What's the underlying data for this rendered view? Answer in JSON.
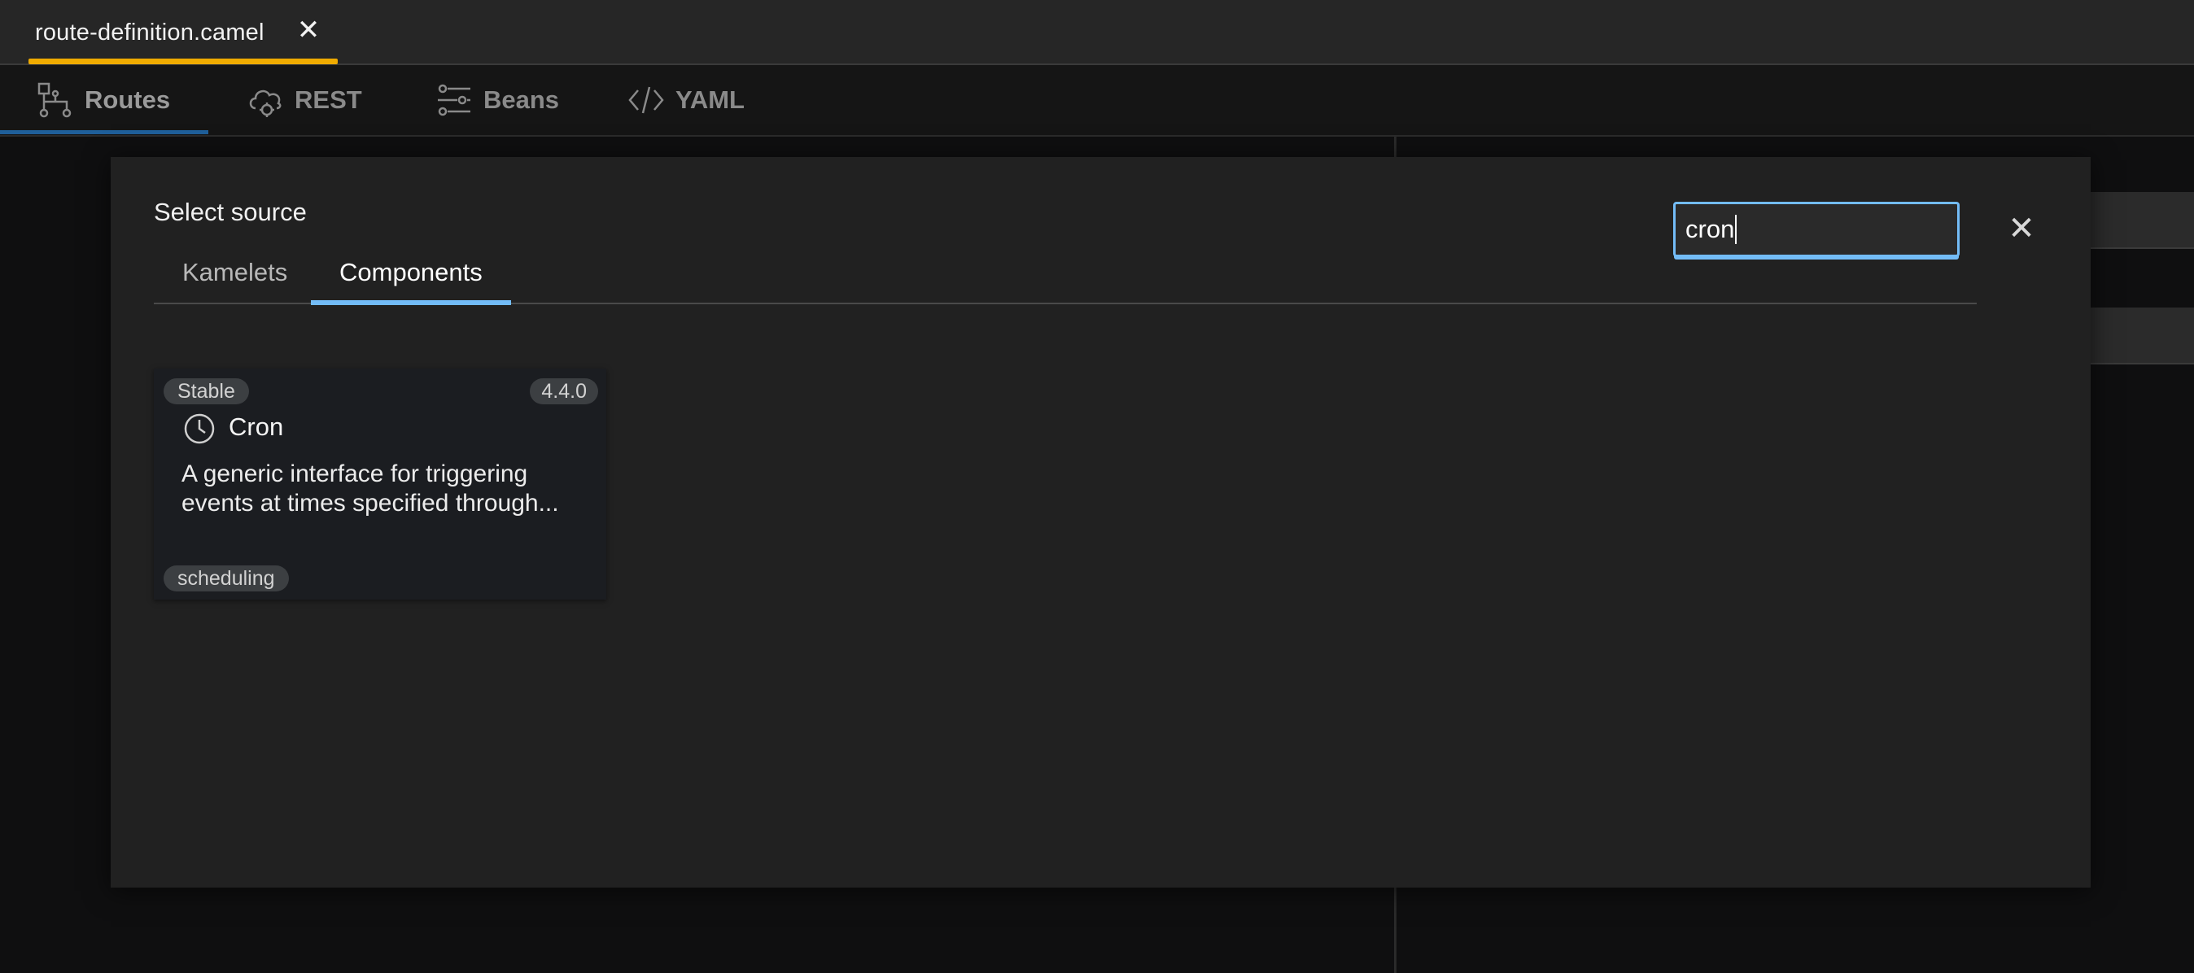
{
  "editor_tab": {
    "filename": "route-definition.camel",
    "close_glyph": "✕"
  },
  "view_tabs": [
    {
      "label": "Routes",
      "icon": "routes-icon",
      "active": true
    },
    {
      "label": "REST",
      "icon": "rest-cloud-icon",
      "active": false
    },
    {
      "label": "Beans",
      "icon": "beans-sliders-icon",
      "active": false
    },
    {
      "label": "YAML",
      "icon": "code-icon",
      "active": false
    }
  ],
  "modal": {
    "title": "Select source",
    "tabs": [
      {
        "label": "Kamelets",
        "active": false
      },
      {
        "label": "Components",
        "active": true
      }
    ],
    "search": {
      "value": "cron",
      "placeholder": ""
    },
    "close_glyph": "✕"
  },
  "cards": [
    {
      "support_level": "Stable",
      "version": "4.4.0",
      "icon": "clock-icon",
      "title": "Cron",
      "description_line1": "A generic interface for triggering",
      "description_line2": "events at times specified through...",
      "label": "scheduling"
    }
  ],
  "colors": {
    "accent_blue": "#73bcf7",
    "file_tab_accent": "#f0ab00",
    "modal_bg": "#212121",
    "page_bg": "#0f0f10"
  }
}
